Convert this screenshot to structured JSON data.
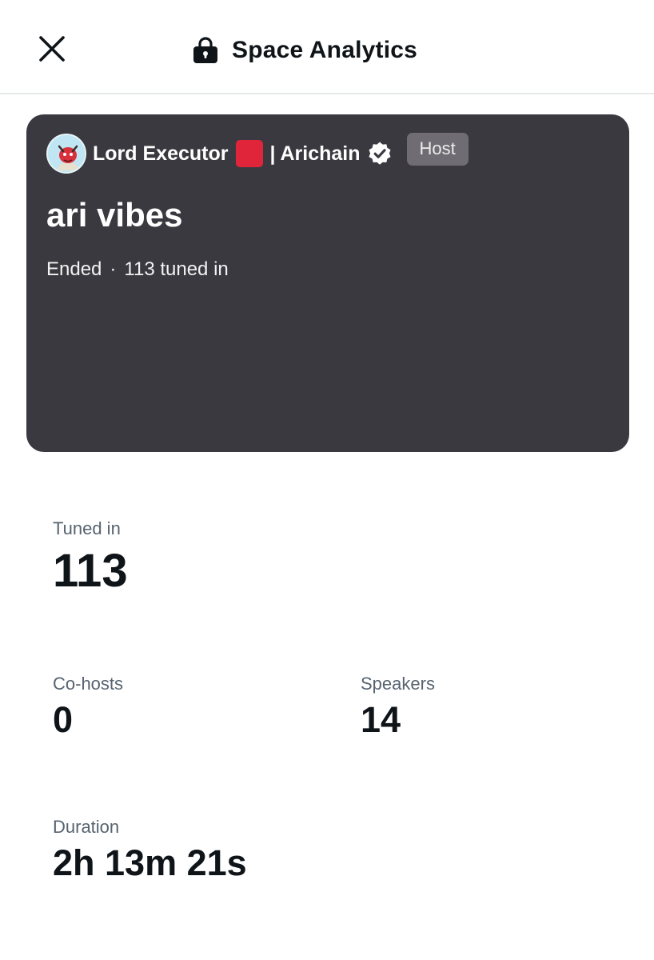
{
  "header": {
    "title": "Space Analytics",
    "close_icon": "close-icon",
    "lock_icon": "lock-icon"
  },
  "space": {
    "host_name": "Lord Executor",
    "host_suffix": "| Arichain",
    "host_badge": "Host",
    "title": "ari vibes",
    "status": "Ended",
    "separator": "·",
    "tuned_in_text": "113 tuned in",
    "card_color": "#3b3940",
    "flag_color": "#e0253a"
  },
  "stats": {
    "tuned_in": {
      "label": "Tuned in",
      "value": "113"
    },
    "cohosts": {
      "label": "Co-hosts",
      "value": "0"
    },
    "speakers": {
      "label": "Speakers",
      "value": "14"
    },
    "duration": {
      "label": "Duration",
      "value": "2h 13m 21s"
    }
  }
}
